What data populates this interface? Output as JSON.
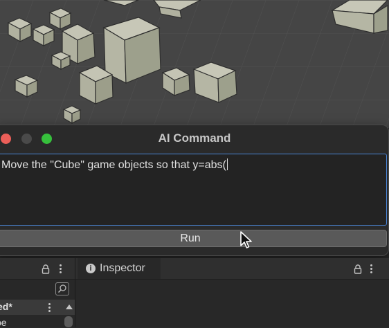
{
  "window": {
    "title": "AI Command",
    "input_value": "Move the \"Cube\" game objects so that y=abs(",
    "run_label": "Run",
    "focus_color": "#4a86d8"
  },
  "traffic_lights": [
    "#ec5f59",
    "#4a4a4a",
    "#36c03c"
  ],
  "hierarchy": {
    "scene_name": "ed*",
    "item": "pe"
  },
  "inspector": {
    "tab_label": "Inspector"
  },
  "icons": [
    "lock-icon",
    "more-options-icon",
    "search-icon",
    "info-icon",
    "mouse-pointer-icon",
    "scroll-up-icon"
  ]
}
